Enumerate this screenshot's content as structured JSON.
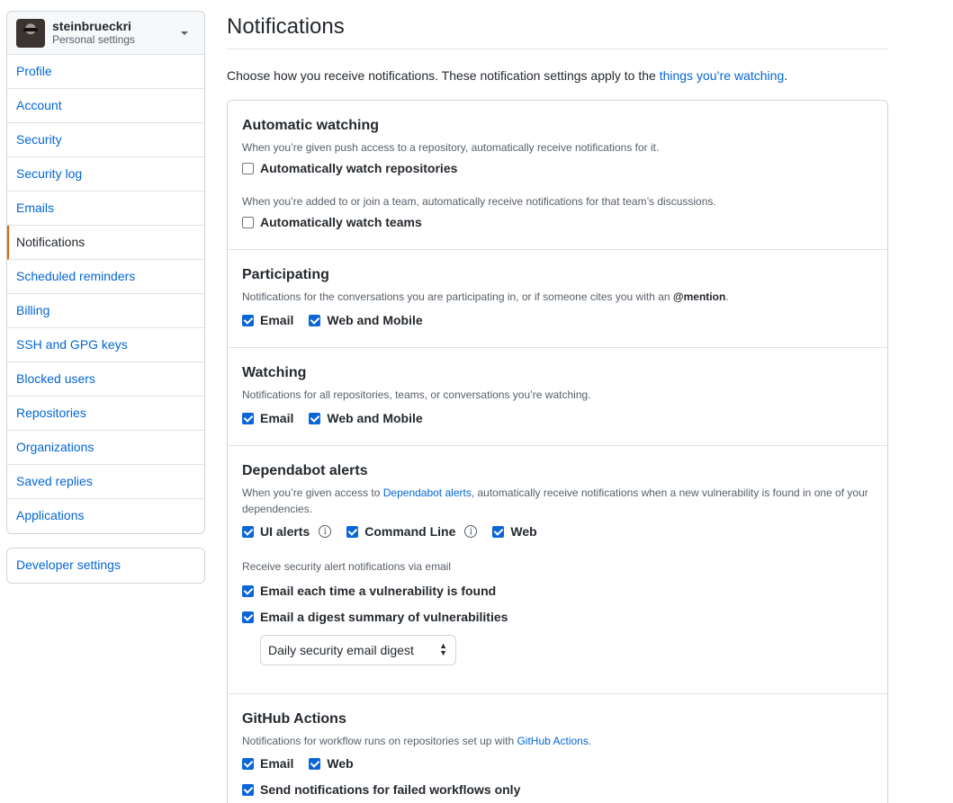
{
  "user": {
    "name": "steinbrueckri",
    "subtitle": "Personal settings"
  },
  "sidebar": {
    "items": [
      {
        "label": "Profile"
      },
      {
        "label": "Account"
      },
      {
        "label": "Security"
      },
      {
        "label": "Security log"
      },
      {
        "label": "Emails"
      },
      {
        "label": "Notifications"
      },
      {
        "label": "Scheduled reminders"
      },
      {
        "label": "Billing"
      },
      {
        "label": "SSH and GPG keys"
      },
      {
        "label": "Blocked users"
      },
      {
        "label": "Repositories"
      },
      {
        "label": "Organizations"
      },
      {
        "label": "Saved replies"
      },
      {
        "label": "Applications"
      }
    ],
    "selected": "Notifications",
    "developer_settings": "Developer settings"
  },
  "main": {
    "title": "Notifications",
    "intro_text": "Choose how you receive notifications. These notification settings apply to the ",
    "intro_link": "things you’re watching",
    "intro_end": ".",
    "automatic": {
      "title": "Automatic watching",
      "note1": "When you’re given push access to a repository, automatically receive notifications for it.",
      "cb1": "Automatically watch repositories",
      "note2": "When you’re added to or join a team, automatically receive notifications for that team’s discussions.",
      "cb2": "Automatically watch teams"
    },
    "participating": {
      "title": "Participating",
      "note": "Notifications for the conversations you are participating in, or if someone cites you with an ",
      "mention": "@mention",
      "note_end": ".",
      "email": "Email",
      "web": "Web and Mobile"
    },
    "watching": {
      "title": "Watching",
      "note": "Notifications for all repositories, teams, or conversations you’re watching.",
      "email": "Email",
      "web": "Web and Mobile"
    },
    "dependabot": {
      "title": "Dependabot alerts",
      "note_start": "When you’re given access to ",
      "note_link": "Dependabot alerts",
      "note_end": ", automatically receive notifications when a new vulnerability is found in one of your dependencies.",
      "ui_alerts": "UI alerts",
      "command_line": "Command Line",
      "web": "Web",
      "email_note": "Receive security alert notifications via email",
      "each": "Email each time a vulnerability is found",
      "digest": "Email a digest summary of vulnerabilities",
      "select_value": "Daily security email digest"
    },
    "actions": {
      "title": "GitHub Actions",
      "note_start": "Notifications for workflow runs on repositories set up with ",
      "note_link": "GitHub Actions",
      "note_end": ".",
      "email": "Email",
      "web": "Web",
      "failed": "Send notifications for failed workflows only"
    }
  }
}
